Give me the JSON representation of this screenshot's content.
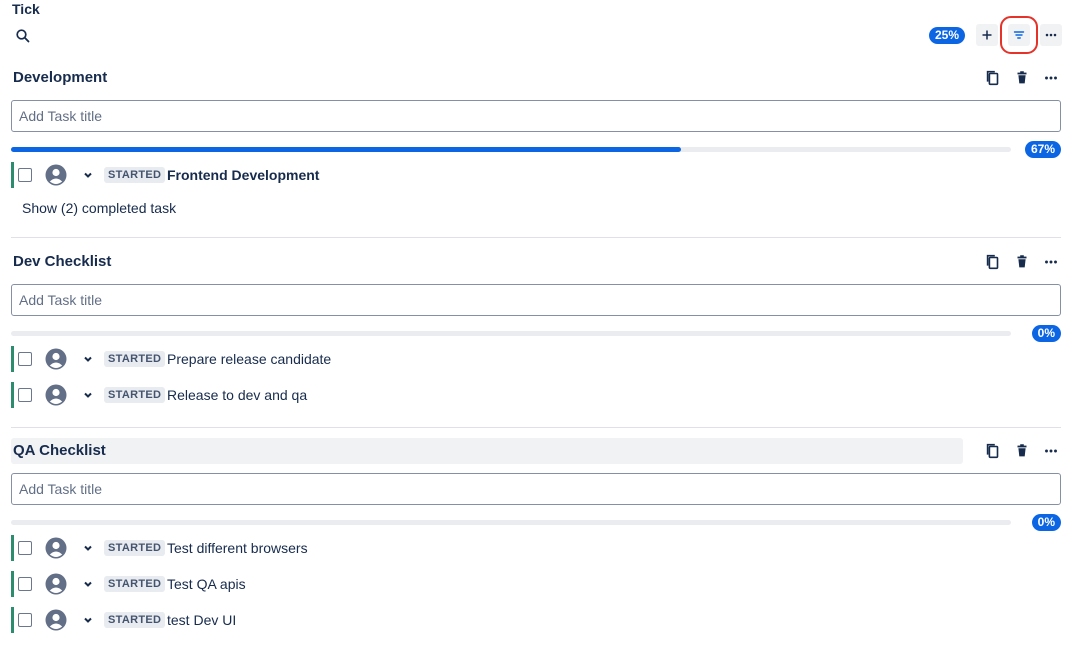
{
  "app": {
    "title": "Tick"
  },
  "toolbar": {
    "progress": "25%"
  },
  "icons": {
    "search": "search-icon",
    "add": "plus-icon",
    "filter": "filter-icon",
    "more": "more-icon",
    "copy": "copy-icon",
    "delete": "trash-icon",
    "avatar": "user-icon",
    "chevron": "chevron-down-icon"
  },
  "colors": {
    "accent": "#0c66e4",
    "task_bar": "#2e8c6e",
    "highlight": "#e5332a"
  },
  "placeholder": "Add Task title",
  "sections": [
    {
      "title": "Development",
      "progress_label": "67%",
      "progress_value": 0.67,
      "tasks": [
        {
          "status": "STARTED",
          "title": "Frontend Development"
        }
      ],
      "show_completed": "Show (2) completed task"
    },
    {
      "title": "Dev Checklist",
      "progress_label": "0%",
      "progress_value": 0,
      "tasks": [
        {
          "status": "STARTED",
          "title": "Prepare release candidate"
        },
        {
          "status": "STARTED",
          "title": "Release to dev and qa"
        }
      ]
    },
    {
      "title": "QA Checklist",
      "progress_label": "0%",
      "progress_value": 0,
      "tasks": [
        {
          "status": "STARTED",
          "title": "Test different browsers"
        },
        {
          "status": "STARTED",
          "title": "Test QA apis"
        },
        {
          "status": "STARTED",
          "title": "test Dev UI"
        }
      ]
    }
  ]
}
